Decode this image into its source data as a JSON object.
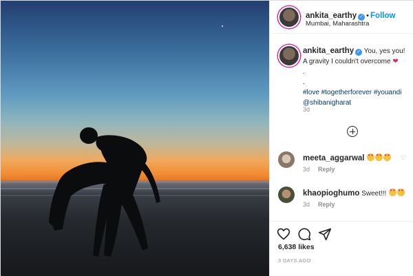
{
  "post": {
    "author": {
      "username": "ankita_earthy",
      "verified": true,
      "follow_label": "Follow",
      "location": "Mumbai, Maharashtra"
    },
    "caption": {
      "username": "ankita_earthy",
      "line1": "You, yes you!",
      "line2": "A gravity I couldn't overcome",
      "dot1": ".",
      "dot2": ".",
      "hashtags": "#love #togetherforever #youandi",
      "mention": "@shibanigharat",
      "time": "3d"
    },
    "load_more_icon": "plus-circle-icon",
    "comments": [
      {
        "username": "meeta_aggarwal",
        "text": "",
        "emoji_count": 3,
        "time": "3d",
        "reply_label": "Reply"
      },
      {
        "username": "khaopioghumo",
        "text": "Sweet!!!",
        "emoji_count": 2,
        "time": "3d",
        "reply_label": "Reply"
      }
    ],
    "actions": {
      "icons": [
        "heart-icon",
        "comment-icon",
        "share-icon"
      ],
      "likes": "6,638 likes",
      "time_ago": "3 DAYS AGO"
    },
    "colors": {
      "link_blue": "#0095f6",
      "hashtag": "#00376b",
      "heart_red": "#e0245e",
      "secondary_text": "#8e8e8e"
    }
  }
}
